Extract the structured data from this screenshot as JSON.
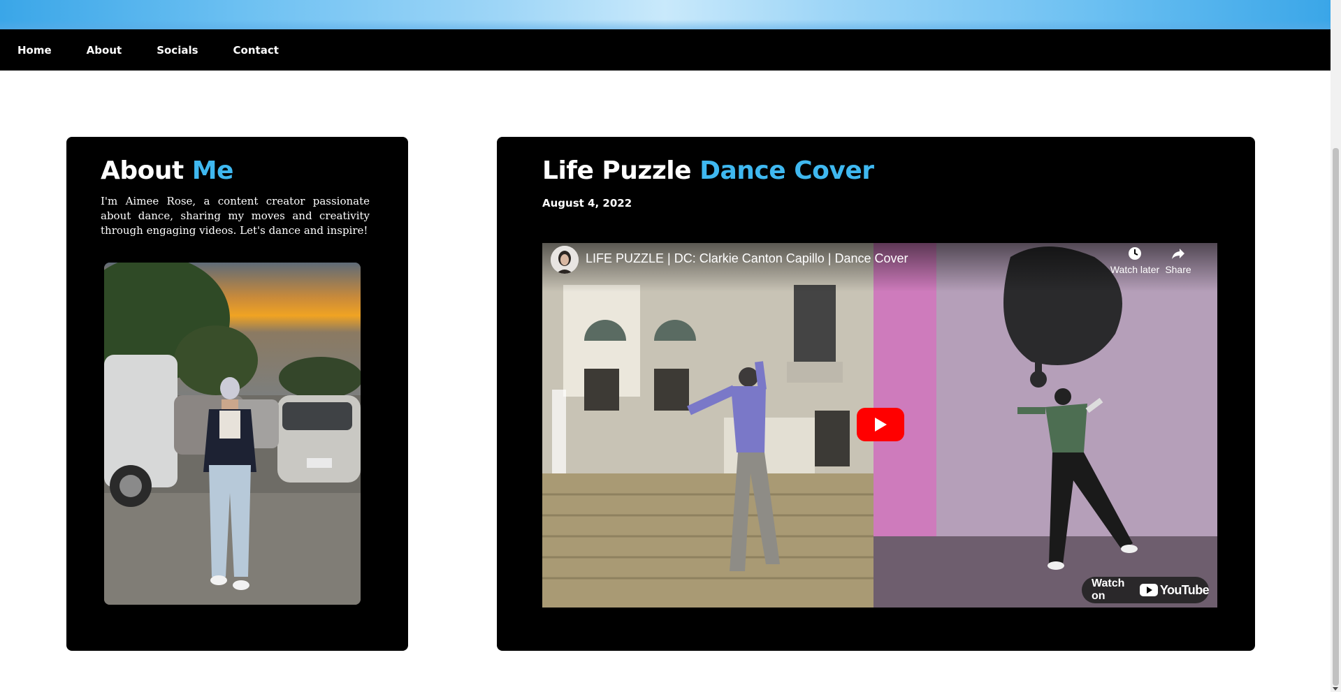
{
  "nav": {
    "items": [
      "Home",
      "About",
      "Socials",
      "Contact"
    ]
  },
  "about": {
    "title_main": "About ",
    "title_accent": "Me",
    "text": "I'm Aimee Rose, a content creator passionate about dance, sharing my moves and creativity through engaging videos. Let's dance and inspire!",
    "photo_alt": "Aimee Rose photo"
  },
  "video_section": {
    "title_main": "Life Puzzle ",
    "title_accent": "Dance Cover",
    "date": "August 4, 2022",
    "player": {
      "video_title": "LIFE PUZZLE | DC: Clarkie Canton Capillo | Dance Cover",
      "watch_later_label": "Watch later",
      "share_label": "Share",
      "watch_on_label": "Watch on",
      "youtube_label": "YouTube"
    }
  },
  "colors": {
    "accent": "#3fb8f0",
    "card_bg": "#000000",
    "nav_bg": "#000000",
    "youtube_red": "#ff0000"
  }
}
